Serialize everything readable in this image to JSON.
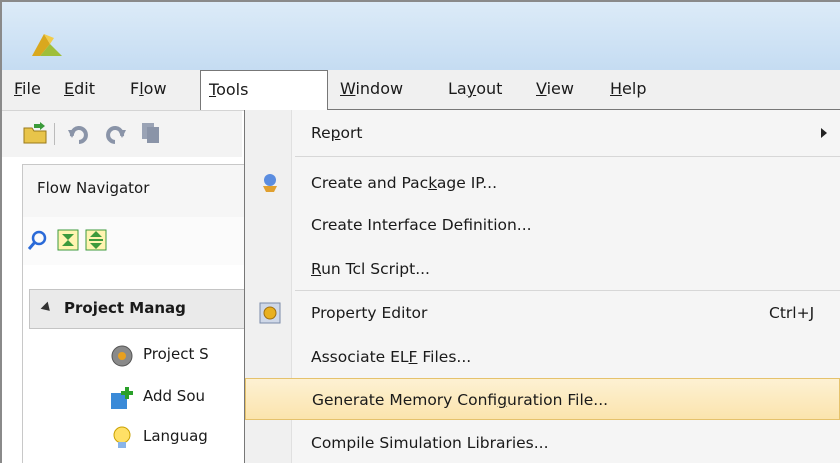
{
  "menubar": {
    "items": [
      {
        "pre": "",
        "u": "F",
        "post": "ile"
      },
      {
        "pre": "",
        "u": "E",
        "post": "dit"
      },
      {
        "pre": "F",
        "u": "l",
        "post": "ow"
      },
      {
        "pre": "",
        "u": "T",
        "post": "ools"
      },
      {
        "pre": "",
        "u": "W",
        "post": "indow"
      },
      {
        "pre": "La",
        "u": "y",
        "post": "out"
      },
      {
        "pre": "",
        "u": "V",
        "post": "iew"
      },
      {
        "pre": "",
        "u": "H",
        "post": "elp"
      }
    ]
  },
  "flow_navigator": {
    "title": "Flow Navigator",
    "project_manager": "Project Manag",
    "items": [
      "Project S",
      "Add Sou",
      "Languag"
    ]
  },
  "tools_menu": {
    "items": [
      {
        "pre": "Re",
        "u": "p",
        "post": "ort",
        "shortcut": "",
        "submenu": true
      },
      {
        "pre": "Create and Pac",
        "u": "k",
        "post": "age IP...",
        "shortcut": "",
        "submenu": false
      },
      {
        "pre": "Create Interface Definition...",
        "u": "",
        "post": "",
        "shortcut": "",
        "submenu": false
      },
      {
        "pre": "",
        "u": "R",
        "post": "un Tcl Script...",
        "shortcut": "",
        "submenu": false
      },
      {
        "pre": "Property Editor",
        "u": "",
        "post": "",
        "shortcut": "Ctrl+J",
        "submenu": false
      },
      {
        "pre": "Associate EL",
        "u": "F",
        "post": " Files...",
        "shortcut": "",
        "submenu": false
      },
      {
        "pre": "Generate Memory Confi",
        "u": "g",
        "post": "uration File...",
        "shortcut": "",
        "submenu": false
      },
      {
        "pre": "Compile Simulation Libraries...",
        "u": "",
        "post": "",
        "shortcut": "",
        "submenu": false
      }
    ],
    "highlighted_index": 6
  },
  "colors": {
    "highlight": "#fbe4ad",
    "titlebar": "#c5dcf2"
  }
}
